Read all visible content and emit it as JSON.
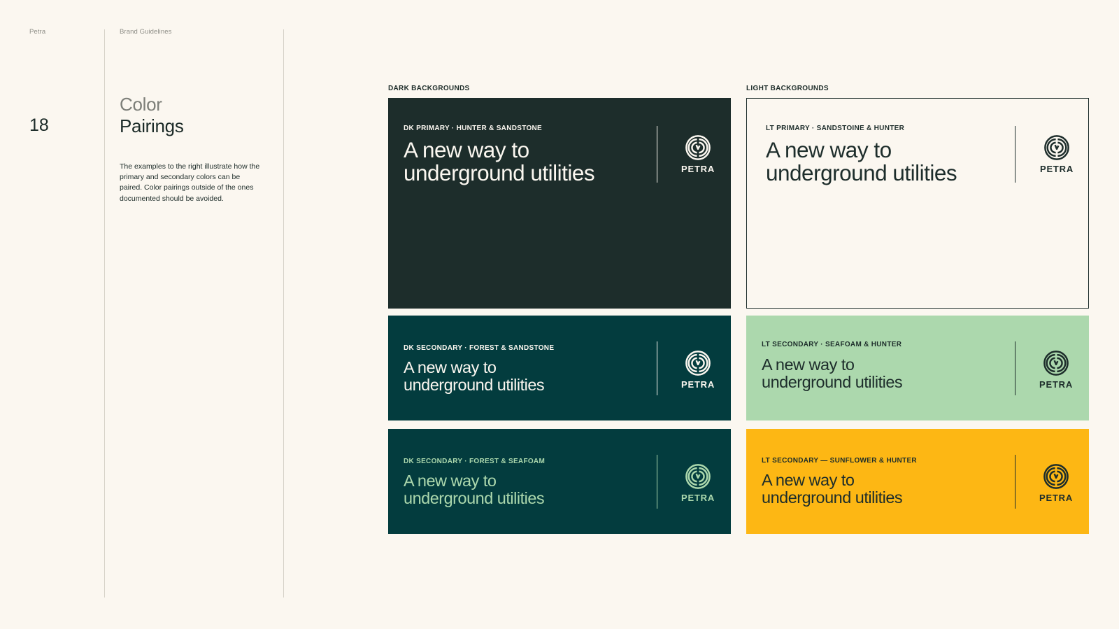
{
  "header": {
    "brand": "Petra",
    "doc": "Brand Guidelines"
  },
  "page": {
    "number": "18",
    "title_line1": "Color",
    "title_line2": "Pairings",
    "description": "The examples to the right illustrate how the primary and secondary colors can be paired. Color pairings outside of the ones documented should be avoided."
  },
  "sections": {
    "dark": "DARK BACKGROUNDS",
    "light": "LIGHT BACKGROUNDS"
  },
  "cards": [
    {
      "label": "DK PRIMARY · HUNTER & SANDSTONE",
      "headline_1": "A new way to",
      "headline_2": "underground utilities",
      "wordmark": "PETRA",
      "icon": "petra-logo-icon",
      "bg": "#1d2d2b",
      "fg": "#fbf7f0"
    },
    {
      "label": "LT PRIMARY · SANDSTOINE & HUNTER",
      "headline_1": "A new way to",
      "headline_2": "underground utilities",
      "wordmark": "PETRA",
      "icon": "petra-logo-icon",
      "bg": "#fbf7f0",
      "fg": "#1d2d2b"
    },
    {
      "label": "DK SECONDARY · FOREST & SANDSTONE",
      "headline_1": "A new way to",
      "headline_2": "underground utilities",
      "wordmark": "PETRA",
      "icon": "petra-logo-icon",
      "bg": "#033c3e",
      "fg": "#fbf7f0"
    },
    {
      "label": "LT SECONDARY · SEAFOAM & HUNTER",
      "headline_1": "A new way to",
      "headline_2": "underground utilities",
      "wordmark": "PETRA",
      "icon": "petra-logo-icon",
      "bg": "#acd8ad",
      "fg": "#1d2d2b"
    },
    {
      "label": "DK SECONDARY · FOREST & SEAFOAM",
      "headline_1": "A new way to",
      "headline_2": "underground utilities",
      "wordmark": "PETRA",
      "icon": "petra-logo-icon",
      "bg": "#033c3e",
      "fg": "#acd8ad"
    },
    {
      "label": "LT SECONDARY — SUNFLOWER & HUNTER",
      "headline_1": "A new way to",
      "headline_2": "underground utilities",
      "wordmark": "PETRA",
      "icon": "petra-logo-icon",
      "bg": "#fdb714",
      "fg": "#1d2d2b"
    }
  ]
}
